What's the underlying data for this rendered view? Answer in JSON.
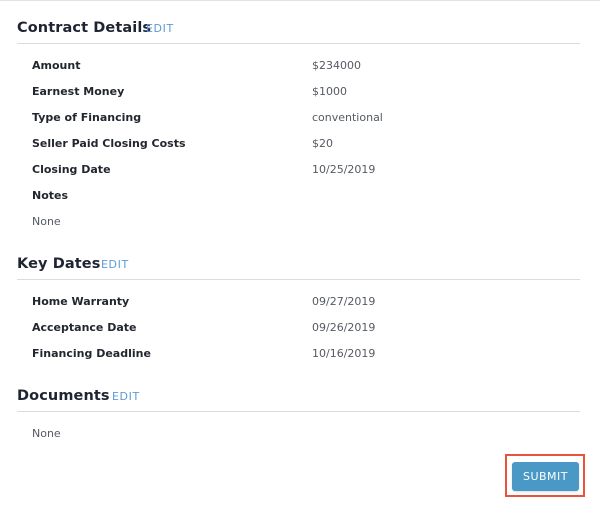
{
  "contract_details": {
    "title": "Contract Details",
    "edit_label": "EDIT",
    "rows": [
      {
        "label": "Amount",
        "value": "$234000"
      },
      {
        "label": "Earnest Money",
        "value": "$1000"
      },
      {
        "label": "Type of Financing",
        "value": "conventional"
      },
      {
        "label": "Seller Paid Closing Costs",
        "value": "$20"
      },
      {
        "label": "Closing Date",
        "value": "10/25/2019"
      }
    ],
    "notes_label": "Notes",
    "notes_value": "None"
  },
  "key_dates": {
    "title": "Key Dates",
    "edit_label": "EDIT",
    "rows": [
      {
        "label": "Home Warranty",
        "value": "09/27/2019"
      },
      {
        "label": "Acceptance Date",
        "value": "09/26/2019"
      },
      {
        "label": "Financing Deadline",
        "value": "10/16/2019"
      }
    ]
  },
  "documents": {
    "title": "Documents",
    "edit_label": "EDIT",
    "value": "None"
  },
  "actions": {
    "submit_label": "SUBMIT"
  },
  "colors": {
    "link": "#5b9bd5",
    "button": "#4a98c5",
    "highlight": "#e8533b"
  }
}
